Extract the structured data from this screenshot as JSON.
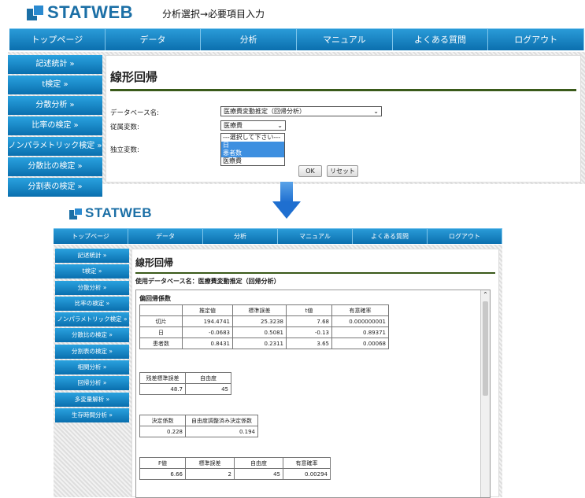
{
  "brand": "STATWEB",
  "subtitle": "分析選択→必要項目入力",
  "nav": [
    "トップページ",
    "データ",
    "分析",
    "マニュアル",
    "よくある質問",
    "ログアウト"
  ],
  "top_sidebar": [
    "記述統計 »",
    "t検定 »",
    "分散分析 »",
    "比率の検定 »",
    "ノンパラメトリック検定 »",
    "分散比の検定 »",
    "分割表の検定 »"
  ],
  "form": {
    "title": "線形回帰",
    "db_label": "データベース名:",
    "db_value": "医療費変動推定（回帰分析）",
    "dep_label": "従属変数:",
    "dep_value": "医療費",
    "indep_label": "独立変数:",
    "indep_options": [
      "---選択して下さい---",
      "日",
      "患者数",
      "医療費"
    ],
    "ok": "OK",
    "reset": "リセット"
  },
  "bottom_sidebar": [
    "記述統計 »",
    "t検定 »",
    "分散分析 »",
    "比率の検定 »",
    "ノンパラメトリック検定 »",
    "分散比の検定 »",
    "分割表の検定 »",
    "相関分析 »",
    "回帰分析 »",
    "多変量解析 »",
    "生存時間分析 »"
  ],
  "result": {
    "title": "線形回帰",
    "db_line": "使用データベース名：医療費変動推定（回帰分析）",
    "coef_title": "偏回帰係数",
    "coef_headers": [
      "",
      "推定値",
      "標準誤差",
      "t値",
      "有意確率"
    ],
    "coef_rows": [
      [
        "切片",
        "194.4741",
        "25.3238",
        "7.68",
        "0.000000001"
      ],
      [
        "日",
        "-0.0683",
        "0.5081",
        "-0.13",
        "0.89371"
      ],
      [
        "患者数",
        "0.8431",
        "0.2311",
        "3.65",
        "0.00068"
      ]
    ],
    "resid_headers": [
      "残差標準誤差",
      "自由度"
    ],
    "resid_values": [
      "48.7",
      "45"
    ],
    "r2_headers": [
      "決定係数",
      "自由度調整済み決定係数"
    ],
    "r2_values": [
      "0.228",
      "0.194"
    ],
    "f_headers": [
      "F値",
      "標準誤差",
      "自由度",
      "有意確率"
    ],
    "f_values": [
      "6.66",
      "2",
      "45",
      "0.00294"
    ]
  },
  "colors": {
    "nav": "#0b6fae",
    "accent_rule": "#3a5a1a",
    "highlight": "#3d8fe0",
    "arrow": "#1f6fd0"
  }
}
